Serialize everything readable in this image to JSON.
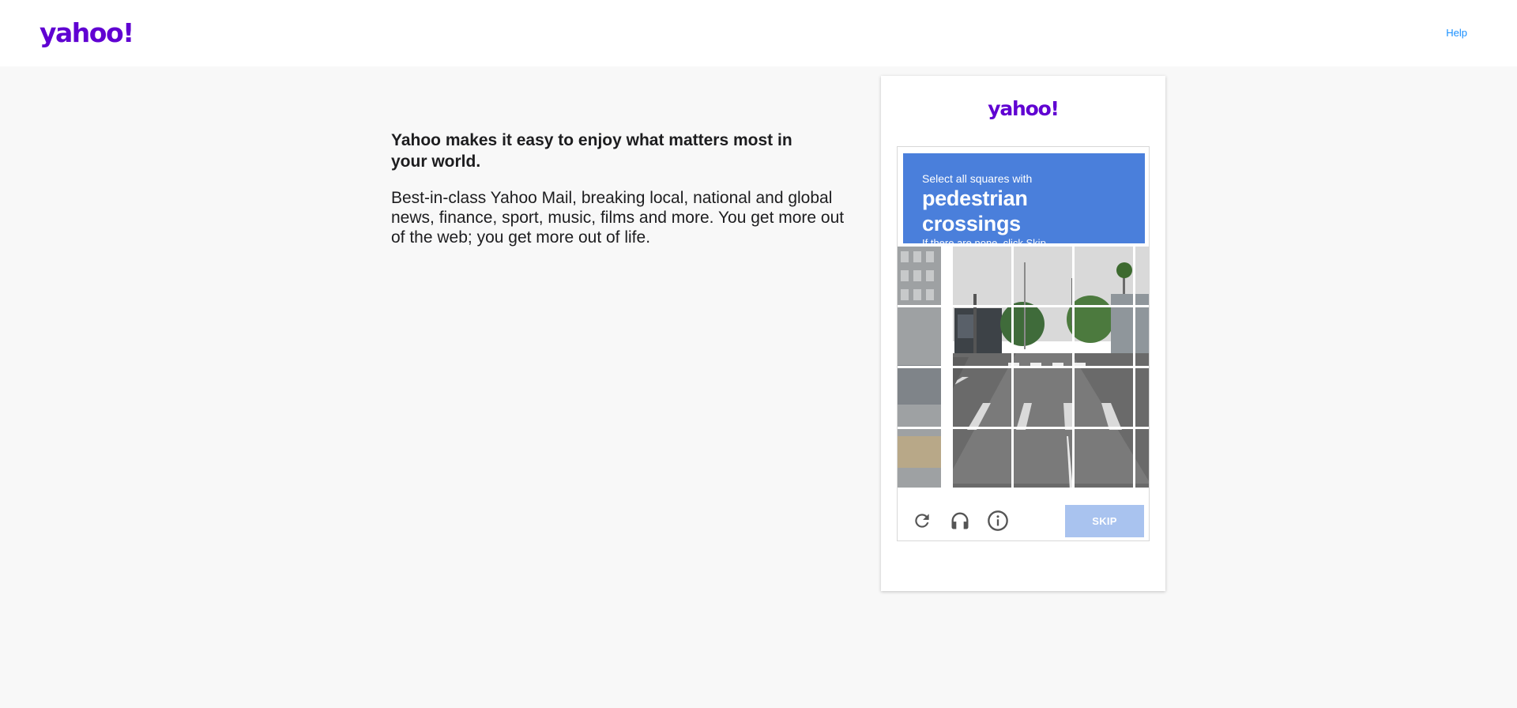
{
  "header": {
    "logo_text": "yahoo!",
    "help_label": "Help"
  },
  "promo": {
    "heading": "Yahoo makes it easy to enjoy what matters most in your world.",
    "body": "Best-in-class Yahoo Mail, breaking local, national and global news, finance, sport, music, films and more. You get more out of the web; you get more out of life."
  },
  "captcha": {
    "logo_text": "yahoo!",
    "instruction_top": "Select all squares with",
    "target": "pedestrian crossings",
    "instruction_bottom": "If there are none, click Skip",
    "skip_label": "SKIP",
    "icons": [
      "refresh-icon",
      "headphones-icon",
      "info-icon"
    ],
    "colors": {
      "prompt_bg": "#4a7fdb",
      "skip_bg": "#a9c3ef",
      "brand": "#6001d2",
      "link": "#188fff"
    }
  }
}
